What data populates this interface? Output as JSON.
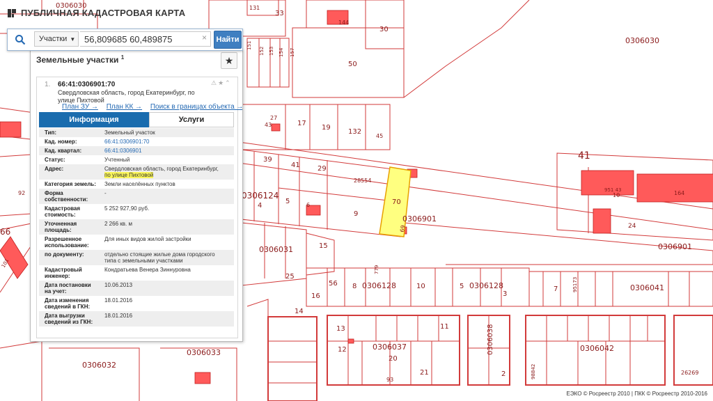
{
  "app": {
    "title": "ПУБЛИЧНАЯ КАДАСТРОВАЯ КАРТА"
  },
  "search": {
    "type_label": "Участки",
    "value": "56,809685 60,489875",
    "clear": "×",
    "button_label": "Найти"
  },
  "panel": {
    "heading": "Земельные участки",
    "count": "1",
    "card": {
      "num": "1.",
      "title": "66:41:0306901:70",
      "address_line1": "Свердловская область, город Екатеринбург, по",
      "address_line2": "улице Пихтовой",
      "links": {
        "plan_zu": "План ЗУ →",
        "plan_kk": "План КК →",
        "search_in": "Поиск в границах объекта →"
      },
      "tabs": {
        "info": "Информация",
        "services": "Услуги"
      },
      "props": {
        "type_label": "Тип:",
        "type_value": "Земельный участок",
        "cad_num_label": "Кад. номер:",
        "cad_num_value": "66:41:0306901:70",
        "cad_quarter_label": "Кад. квартал:",
        "cad_quarter_value": "66:41:0306901",
        "status_label": "Статус:",
        "status_value": "Учтенный",
        "address_label": "Адрес:",
        "address_value1": "Свердловская область, город Екатеринбург,",
        "address_value2": "по улице Пихтовой",
        "category_label": "Категория земель:",
        "category_value": "Земли населённых пунктов",
        "ownership_label1": "Форма",
        "ownership_label2": "собственности:",
        "ownership_value": "-",
        "cost_label1": "Кадастровая",
        "cost_label2": "стоимость:",
        "cost_value": "5 252 927,90 руб.",
        "area_label1": "Уточненная",
        "area_label2": "площадь:",
        "area_value": "2 266 кв. м",
        "use_label1": "Разрешенное",
        "use_label2": "использование:",
        "use_value": "Для иных видов жилой застройки",
        "bydoc_label": "по документу:",
        "bydoc_value1": "отдельно стоящие жилые дома городского",
        "bydoc_value2": "типа с земельными участками",
        "engineer_label1": "Кадастровый",
        "engineer_label2": "инженер:",
        "engineer_value": "Кондратьева Венера Зиннуровна",
        "reg_date_label1": "Дата постановки",
        "reg_date_label2": "на учет:",
        "reg_date_value": "10.06.2013",
        "change_date_label1": "Дата изменения",
        "change_date_label2": "сведений в ГКН:",
        "change_date_value": "18.01.2016",
        "export_date_label1": "Дата выгрузки",
        "export_date_label2": "сведений из ГКН:",
        "export_date_value": "18.01.2016"
      }
    }
  },
  "map": {
    "labels": {
      "q0306030_top": "0306030",
      "q0306030_right": "0306030",
      "q0306124": "0306124",
      "q0306901_mid": "0306901",
      "q0306901_right": "0306901",
      "q0306031": "0306031",
      "q0306128_a": "0306128",
      "q0306128_b": "0306128",
      "q0306041": "0306041",
      "q0306037": "0306037",
      "q0306038": "0306038",
      "q0306042": "0306042",
      "q0306032": "0306032",
      "q0306033": "0306033",
      "big41": "41",
      "p70": "70",
      "p69": "69",
      "p28554": "28554",
      "p9": "9",
      "p5": "5",
      "p4": "4",
      "p6": "6",
      "p39": "39",
      "p41": "41",
      "p29": "29",
      "p27": "27",
      "p17": "17",
      "p19": "19",
      "p132": "132",
      "p45": "45",
      "p43": "43",
      "p33": "33",
      "p30": "30",
      "p50": "50",
      "p131": "131",
      "p144": "144",
      "p151": "151",
      "p152": "152",
      "p153": "153",
      "p154": "154",
      "p157": "157",
      "p24": "24",
      "p10": "10",
      "p95143": "951 43",
      "p164": "164",
      "p92": "92",
      "p66": "66",
      "p101": "101",
      "p15": "15",
      "p25": "25",
      "p14": "14",
      "p16": "16",
      "p56": "56",
      "p8": "8",
      "p10b": "10",
      "p5b": "5",
      "p7": "7",
      "p3": "3",
      "p95173": "95173",
      "p13": "13",
      "p11": "11",
      "p12": "12",
      "p20": "20",
      "p21": "21",
      "p93": "93",
      "p2": "2",
      "p26269": "26269",
      "p779": "779",
      "p98842": "98842"
    }
  },
  "footer": {
    "copyright": "ЕЭКО © Росреестр 2010 | ПКК © Росреестр 2010-2016"
  }
}
